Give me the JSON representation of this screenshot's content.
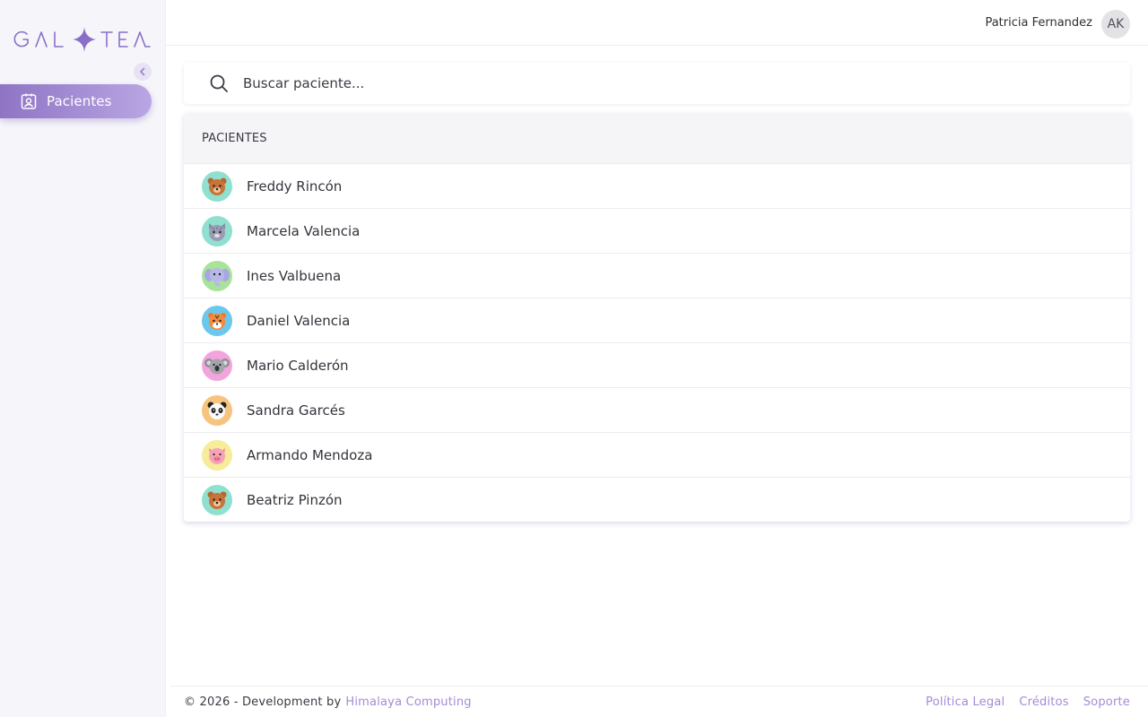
{
  "brand": {
    "logo_text": "GALTEA"
  },
  "sidebar": {
    "collapse_icon": "chevron-left-icon",
    "items": [
      {
        "label": "Pacientes",
        "icon": "patient-badge-icon",
        "active": true
      }
    ]
  },
  "header": {
    "user_name": "Patricia Fernandez",
    "user_initials": "AK"
  },
  "search": {
    "placeholder": "Buscar paciente...",
    "value": ""
  },
  "patients": {
    "title": "PACIENTES",
    "rows": [
      {
        "name": "Freddy Rincón",
        "avatar": "bear",
        "avatar_bg": "#8fe0cf"
      },
      {
        "name": "Marcela Valencia",
        "avatar": "cat",
        "avatar_bg": "#8fe0cf"
      },
      {
        "name": "Ines Valbuena",
        "avatar": "elephant",
        "avatar_bg": "#a8e39a"
      },
      {
        "name": "Daniel Valencia",
        "avatar": "tiger",
        "avatar_bg": "#6cc7ec"
      },
      {
        "name": "Mario Calderón",
        "avatar": "koala",
        "avatar_bg": "#f2a4dc"
      },
      {
        "name": "Sandra Garcés",
        "avatar": "panda",
        "avatar_bg": "#f7c47f"
      },
      {
        "name": "Armando Mendoza",
        "avatar": "pig",
        "avatar_bg": "#f6ec9a"
      },
      {
        "name": "Beatriz Pinzón",
        "avatar": "bear",
        "avatar_bg": "#8fe0cf"
      }
    ]
  },
  "footer": {
    "copyright": "© 2026 - Development by",
    "company": "Himalaya Computing",
    "links": [
      "Política Legal",
      "Créditos",
      "Soporte"
    ]
  },
  "colors": {
    "accent": "#9b7fd1",
    "accent_light": "#b9a6e3",
    "sidebar_bg": "#f6f6fa"
  }
}
